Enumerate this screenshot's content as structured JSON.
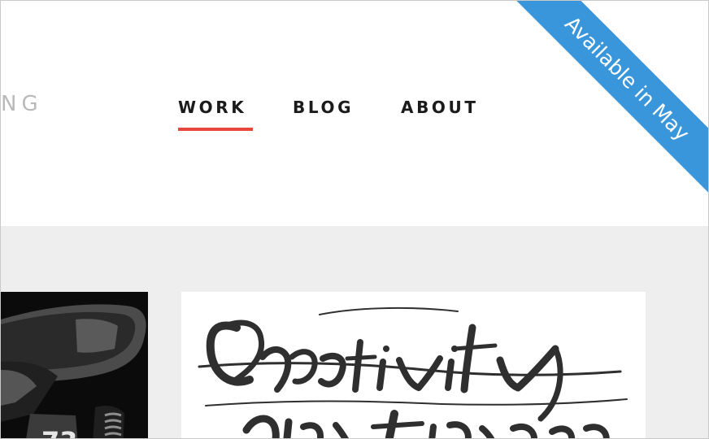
{
  "brand": {
    "visible_text": "NG"
  },
  "nav": {
    "items": [
      {
        "label": "WORK",
        "active": true
      },
      {
        "label": "BLOG",
        "active": false
      },
      {
        "label": "ABOUT",
        "active": false
      }
    ]
  },
  "ribbon": {
    "text": "Available in May",
    "color": "#3a96da"
  },
  "colors": {
    "accent_underline": "#e8453c",
    "content_background": "#eeeeee",
    "nav_text": "#1b1b1b",
    "logo_text": "#b9b9b9"
  },
  "portfolio": {
    "items": [
      {
        "type": "photo",
        "visible_number": "73",
        "icon": "motorcycle-photo"
      },
      {
        "type": "lettering-artwork",
        "icon": "calligraphy-artwork"
      }
    ]
  }
}
